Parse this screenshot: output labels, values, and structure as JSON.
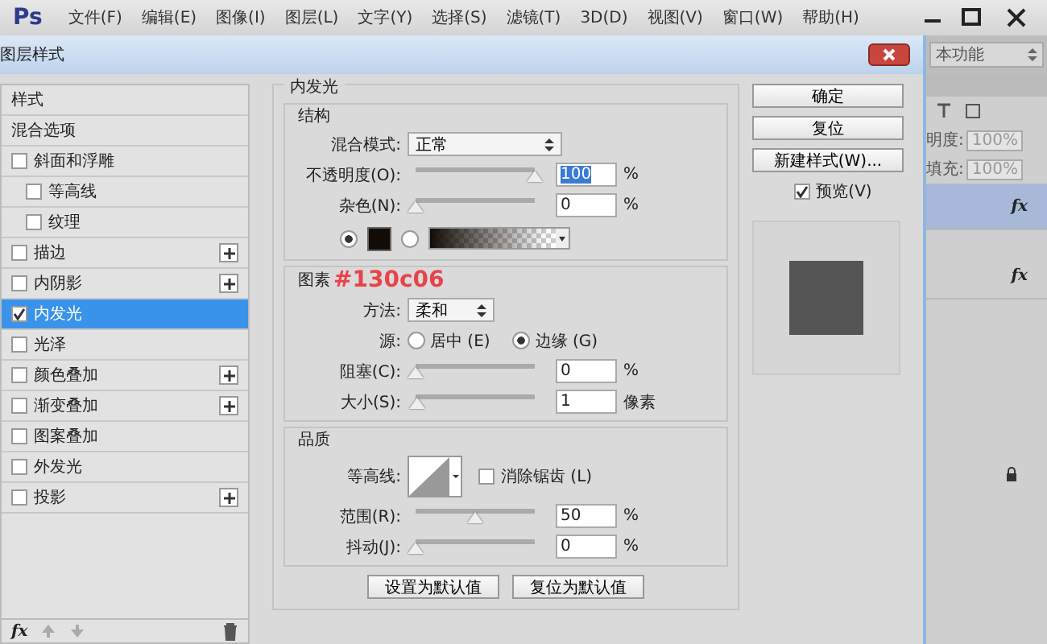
{
  "app": {
    "logo": "Ps",
    "menu": [
      "文件(F)",
      "编辑(E)",
      "图像(I)",
      "图层(L)",
      "文字(Y)",
      "选择(S)",
      "滤镜(T)",
      "3D(D)",
      "视图(V)",
      "窗口(W)",
      "帮助(H)"
    ]
  },
  "workspace": {
    "value": "本功能"
  },
  "dialog": {
    "title": "图层样式",
    "styles": [
      {
        "label": "样式",
        "kind": "header",
        "selected": false
      },
      {
        "label": "混合选项",
        "kind": "header",
        "selected": false
      },
      {
        "label": "斜面和浮雕",
        "kind": "check",
        "checked": false,
        "selected": false,
        "add": false,
        "children": [
          {
            "label": "等高线",
            "kind": "check",
            "checked": false,
            "selected": false,
            "add": false
          },
          {
            "label": "纹理",
            "kind": "check",
            "checked": false,
            "selected": false,
            "add": false
          }
        ]
      },
      {
        "label": "描边",
        "kind": "check",
        "checked": false,
        "selected": false,
        "add": true
      },
      {
        "label": "内阴影",
        "kind": "check",
        "checked": false,
        "selected": false,
        "add": true
      },
      {
        "label": "内发光",
        "kind": "check",
        "checked": true,
        "selected": true,
        "add": false
      },
      {
        "label": "光泽",
        "kind": "check",
        "checked": false,
        "selected": false,
        "add": false
      },
      {
        "label": "颜色叠加",
        "kind": "check",
        "checked": false,
        "selected": false,
        "add": true
      },
      {
        "label": "渐变叠加",
        "kind": "check",
        "checked": false,
        "selected": false,
        "add": true
      },
      {
        "label": "图案叠加",
        "kind": "check",
        "checked": false,
        "selected": false,
        "add": false
      },
      {
        "label": "外发光",
        "kind": "check",
        "checked": false,
        "selected": false,
        "add": false
      },
      {
        "label": "投影",
        "kind": "check",
        "checked": false,
        "selected": false,
        "add": true
      }
    ],
    "list_footer": {
      "fx": "fx"
    },
    "panel": {
      "title": "内发光",
      "structure": {
        "title": "结构",
        "blend_mode": {
          "label": "混合模式:",
          "value": "正常"
        },
        "opacity": {
          "label": "不透明度(O):",
          "level": 1,
          "value": "100",
          "unit": "%"
        },
        "noise": {
          "label": "杂色(N):",
          "level": 0,
          "value": "0",
          "unit": "%"
        },
        "fill": [
          {
            "kind": "color",
            "selected": true,
            "color": "#130c06"
          },
          {
            "kind": "gradient",
            "selected": false
          }
        ]
      },
      "elements": {
        "title": "图素",
        "annotation": "#130c06",
        "method": {
          "label": "方法:",
          "value": "柔和"
        },
        "source": {
          "label": "源:",
          "options": [
            {
              "label": "居中 (E)",
              "selected": false
            },
            {
              "label": "边缘 (G)",
              "selected": true
            }
          ]
        },
        "choke": {
          "label": "阻塞(C):",
          "level": 0,
          "value": "0",
          "unit": "%"
        },
        "size": {
          "label": "大小(S):",
          "level": 0.01,
          "value": "1",
          "unit": "像素"
        }
      },
      "quality": {
        "title": "品质",
        "contour_label": "等高线:",
        "antialias": {
          "label": "消除锯齿 (L)",
          "checked": false
        },
        "range": {
          "label": "范围(R):",
          "level": 0.5,
          "value": "50",
          "unit": "%"
        },
        "jitter": {
          "label": "抖动(J):",
          "level": 0,
          "value": "0",
          "unit": "%"
        }
      },
      "defaults": [
        "设置为默认值",
        "复位为默认值"
      ]
    },
    "actions": [
      "确定",
      "复位",
      "新建样式(W)..."
    ],
    "preview": {
      "label": "预览(V)",
      "checked": true
    }
  },
  "layers": {
    "opacity_label": "明度:",
    "opacity": "100%",
    "fill_label": "填充:",
    "fill": "100%",
    "items": [
      {
        "selected": true,
        "fx": "fx"
      },
      {
        "selected": false,
        "fx": "fx"
      }
    ]
  }
}
